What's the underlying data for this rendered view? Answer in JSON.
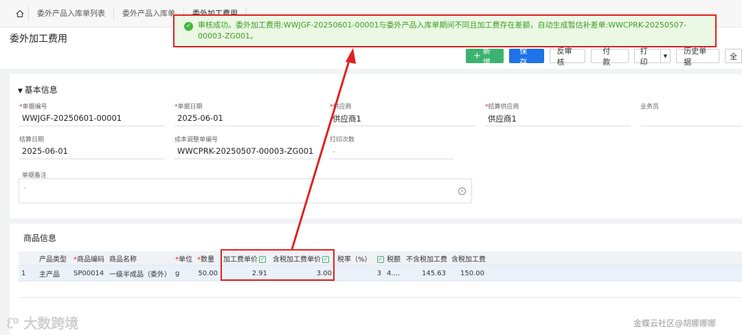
{
  "tabs": [
    "委外产品入库单列表",
    "委外产品入库单",
    "委外加工费用"
  ],
  "page_title": "委外加工费用",
  "toast": {
    "line1": "审核成功。委外加工费用:WWJGF-20250601-00001与委外产品入库单期间不同且加工费存在差额，自动生成暂估补差单:WWCPRK-20250507-",
    "line2": "00003-ZG001。"
  },
  "toolbar": {
    "new": "新增",
    "save": "保存",
    "unaudit": "反审核",
    "pay": "付款",
    "print": "打印",
    "history": "历史单据",
    "more": "全"
  },
  "basic": {
    "section_title": "基本信息",
    "fields": {
      "doc_no": {
        "label": "单据编号",
        "value": "WWJGF-20250601-00001"
      },
      "doc_date": {
        "label": "单据日期",
        "value": "2025-06-01"
      },
      "supplier": {
        "label": "供应商",
        "value": "供应商1"
      },
      "settle_supplier": {
        "label": "结算供应商",
        "value": "供应商1"
      },
      "salesman": {
        "label": "业务员",
        "value": ""
      },
      "settle_date": {
        "label": "结算日期",
        "value": "2025-06-01"
      },
      "adj_no": {
        "label": "成本调整单编号",
        "value": "WWCPRK-20250507-00003-ZG001"
      },
      "print_count": {
        "label": "打印次数",
        "value": "-"
      },
      "remark": {
        "label": "单据备注",
        "value": "-"
      }
    }
  },
  "goods": {
    "section_title": "商品信息",
    "headers": [
      "产品类型",
      "商品编码",
      "商品名称",
      "单位",
      "数量",
      "加工费单价",
      "含税加工费单价",
      "税率（%）",
      "税额",
      "不含税加工费",
      "含税加工费"
    ],
    "row": {
      "no": "1",
      "type": "主产品",
      "code": "SP00014",
      "name": "一级半成品（委外）",
      "unit": "g",
      "qty": "50.00",
      "price": "2.91",
      "price_tax": "3.00",
      "tax_rate": "3",
      "tax": "4....",
      "amount": "145.63",
      "amount_tax": "150.00"
    }
  },
  "watermark": {
    "left": "大数跨境",
    "right": "金蝶云社区@胡娜娜娜"
  },
  "colors": {
    "primary": "#1e73e8",
    "success": "#3cb371",
    "highlight": "#e02020"
  }
}
